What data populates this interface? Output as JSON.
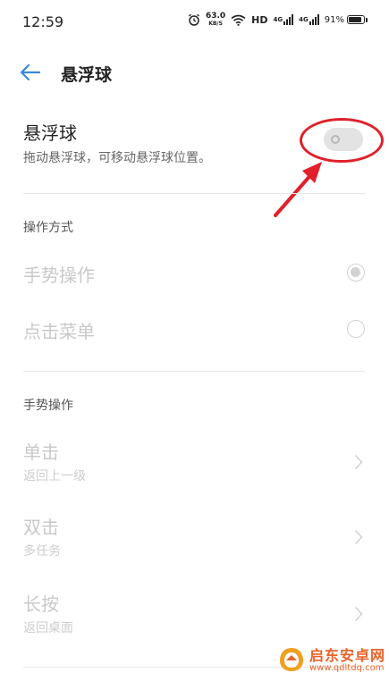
{
  "status_bar": {
    "time": "12:59",
    "net_speed": "63.0",
    "net_speed_unit": "KB/S",
    "hd_label": "HD",
    "sim1_label": "4G",
    "sim2_label": "4G",
    "battery_text": "91%",
    "battery_level": 0.91
  },
  "header": {
    "title": "悬浮球",
    "back_icon": "arrow-left-icon"
  },
  "toggle": {
    "title": "悬浮球",
    "subtitle": "拖动悬浮球，可移动悬浮球位置。",
    "enabled": false
  },
  "operation_mode": {
    "header": "操作方式",
    "options": [
      {
        "label": "手势操作",
        "selected": true
      },
      {
        "label": "点击菜单",
        "selected": false
      }
    ]
  },
  "gesture": {
    "header": "手势操作",
    "items": [
      {
        "label": "单击",
        "value": "返回上一级"
      },
      {
        "label": "双击",
        "value": "多任务"
      },
      {
        "label": "长按",
        "value": "返回桌面"
      }
    ]
  },
  "annotation": {
    "color": "#e0202a"
  },
  "watermark": {
    "text": "启东安卓网",
    "url": "www.qdltdq.com"
  }
}
